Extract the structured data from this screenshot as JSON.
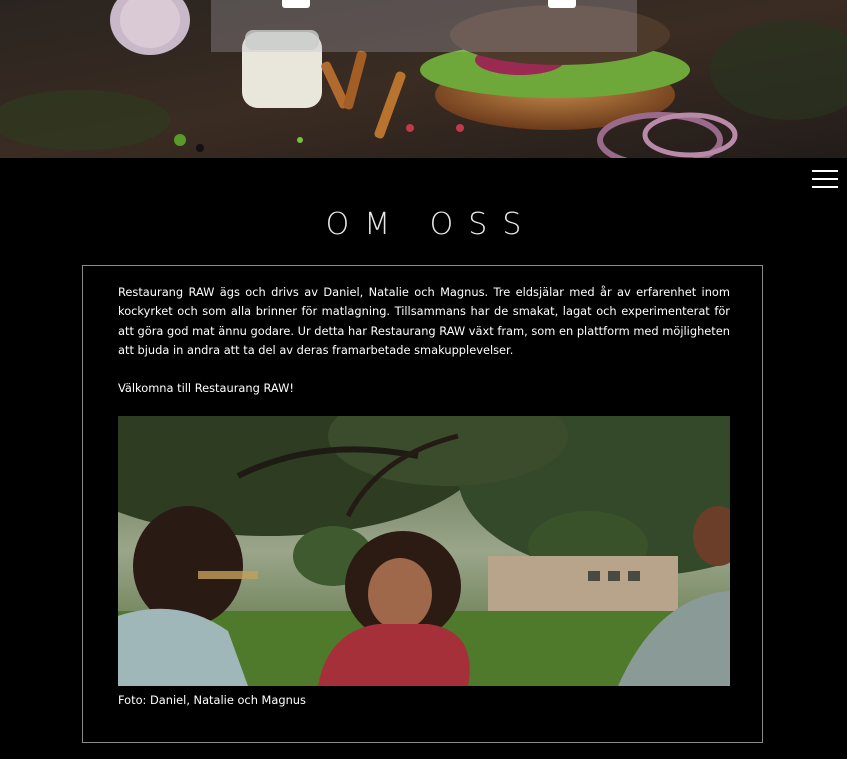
{
  "hero": {
    "image": "food-table-photo",
    "panel": "translucent-nav-panel"
  },
  "nav": {
    "menu_icon": "hamburger-icon"
  },
  "about": {
    "heading": "OM OSS",
    "paragraph": "Restaurang RAW ägs och drivs av Daniel, Natalie och Magnus. Tre eldsjälar med år av erfarenhet inom kockyrket och som alla brinner för matlagning. Tillsammans har de smakat, lagat och experimenterat för att göra god mat ännu godare. Ur detta har Restaurang RAW växt fram, som en plattform med möjligheten att bjuda in andra att ta del av deras framarbetade smakupplevelser.",
    "welcome": "Välkomna till Restaurang RAW!",
    "photo": "three-people-in-park-photo",
    "caption": "Foto: Daniel, Natalie och Magnus"
  },
  "colors": {
    "background": "#000000",
    "text": "#ffffff",
    "border": "#8a8a8a"
  }
}
